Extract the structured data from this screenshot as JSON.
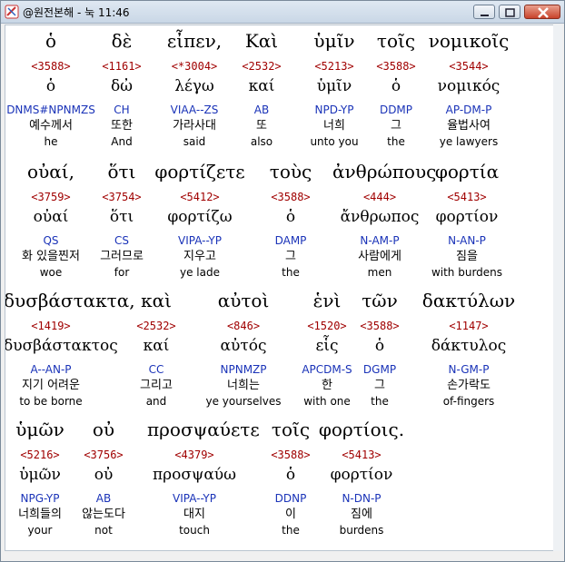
{
  "window": {
    "title": "@원전본해 - 눅 11:46"
  },
  "rows": [
    [
      {
        "greek": "ὁ",
        "strong": "<3588>",
        "lex": "ὁ",
        "parse": "DNMS#NPNMZS",
        "ko": "예수께서",
        "en": "he"
      },
      {
        "greek": "δὲ",
        "strong": "<1161>",
        "lex": "δὠ",
        "parse": "CH",
        "ko": "또한",
        "en": "And"
      },
      {
        "greek": "εἶπεν,",
        "strong": "<*3004>",
        "lex": "λέγω",
        "parse": "VIAA--ZS",
        "ko": "가라사대",
        "en": "said"
      },
      {
        "greek": "Καὶ",
        "strong": "<2532>",
        "lex": "καί",
        "parse": "AB",
        "ko": "또",
        "en": "also"
      },
      {
        "greek": "ὑμῖν",
        "strong": "<5213>",
        "lex": "ὑμῖν",
        "parse": "NPD-YP",
        "ko": "너희",
        "en": "unto you"
      },
      {
        "greek": "τοῖς",
        "strong": "<3588>",
        "lex": "ὁ",
        "parse": "DDMP",
        "ko": "그",
        "en": "the"
      },
      {
        "greek": "νομικοῖς",
        "strong": "<3544>",
        "lex": "νομικός",
        "parse": "AP-DM-P",
        "ko": "율법사여",
        "en": "ye lawyers"
      }
    ],
    [
      {
        "greek": "οὐαί,",
        "strong": "<3759>",
        "lex": "οὐαί",
        "parse": "QS",
        "ko": "화 있을찐저",
        "en": "woe"
      },
      {
        "greek": "ὅτι",
        "strong": "<3754>",
        "lex": "ὅτι",
        "parse": "CS",
        "ko": "그러므로",
        "en": "for"
      },
      {
        "greek": "φορτίζετε",
        "strong": "<5412>",
        "lex": "φορτίζω",
        "parse": "VIPA--YP",
        "ko": "지우고",
        "en": "ye lade"
      },
      {
        "greek": "τοὺς",
        "strong": "<3588>",
        "lex": "ὁ",
        "parse": "DAMP",
        "ko": "그",
        "en": "the"
      },
      {
        "greek": "ἀνθρώπους",
        "strong": "<444>",
        "lex": "ἄνθρωπος",
        "parse": "N-AM-P",
        "ko": "사람에게",
        "en": "men"
      },
      {
        "greek": "φορτία",
        "strong": "<5413>",
        "lex": "φορτίον",
        "parse": "N-AN-P",
        "ko": "짐을",
        "en": "with burdens"
      }
    ],
    [
      {
        "greek": "δυσβάστακτα,",
        "strong": "<1419>",
        "lex": "δυσβάστακτος",
        "parse": "A--AN-P",
        "ko": "지기 어려운",
        "en": "to be borne"
      },
      {
        "greek": "καὶ",
        "strong": "<2532>",
        "lex": "καί",
        "parse": "CC",
        "ko": "그리고",
        "en": "and"
      },
      {
        "greek": "αὐτοὶ",
        "strong": "<846>",
        "lex": "αὐτός",
        "parse": "NPNMZP",
        "ko": "너희는",
        "en": "ye yourselves"
      },
      {
        "greek": "ἑνὶ",
        "strong": "<1520>",
        "lex": "εἷς",
        "parse": "APCDM-S",
        "ko": "한",
        "en": "with one"
      },
      {
        "greek": "τῶν",
        "strong": "<3588>",
        "lex": "ὁ",
        "parse": "DGMP",
        "ko": "그",
        "en": "the"
      },
      {
        "greek": "δακτύλων",
        "strong": "<1147>",
        "lex": "δάκτυλος",
        "parse": "N-GM-P",
        "ko": "손가락도",
        "en": "of-fingers"
      }
    ],
    [
      {
        "greek": "ὑμῶν",
        "strong": "<5216>",
        "lex": "ὑμῶν",
        "parse": "NPG-YP",
        "ko": "너희들의",
        "en": "your"
      },
      {
        "greek": "οὐ",
        "strong": "<3756>",
        "lex": "οὐ",
        "parse": "AB",
        "ko": "않는도다",
        "en": "not"
      },
      {
        "greek": "προσψαύετε",
        "strong": "<4379>",
        "lex": "προσψαύω",
        "parse": "VIPA--YP",
        "ko": "대지",
        "en": "touch"
      },
      {
        "greek": "τοῖς",
        "strong": "<3588>",
        "lex": "ὁ",
        "parse": "DDNP",
        "ko": "이",
        "en": "the"
      },
      {
        "greek": "φορτίοις.",
        "strong": "<5413>",
        "lex": "φορτίον",
        "parse": "N-DN-P",
        "ko": "짐에",
        "en": "burdens"
      }
    ]
  ]
}
